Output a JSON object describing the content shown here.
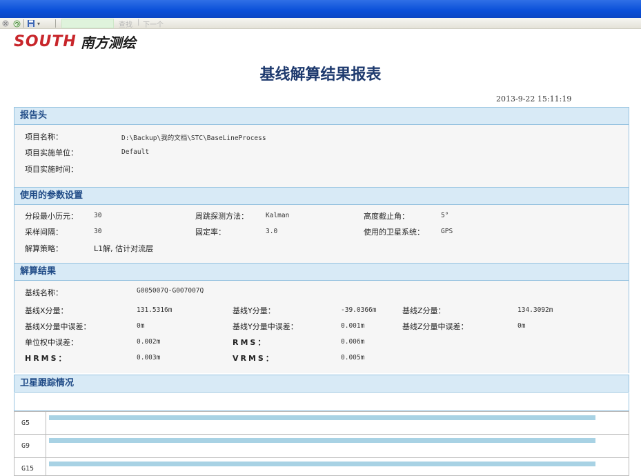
{
  "toolbar": {
    "find_label": "查找",
    "next_label": "下一个",
    "icons": [
      "stop-icon",
      "refresh-icon",
      "save-icon",
      "dropdown-arrow-icon"
    ]
  },
  "logo": {
    "brand": "SOUTH",
    "cn": "南方测绘"
  },
  "report": {
    "title": "基线解算结果报表",
    "timestamp": "2013-9-22 15:11:19"
  },
  "header_section": {
    "title": "报告头",
    "rows": [
      {
        "label": "项目名称：",
        "value": "D:\\Backup\\我的文档\\STC\\BaseLineProcess"
      },
      {
        "label": "项目实施单位：",
        "value": "Default"
      },
      {
        "label": "项目实施时间：",
        "value": ""
      }
    ]
  },
  "params_section": {
    "title": "使用的参数设置",
    "min_epoch_label": "分段最小历元：",
    "min_epoch_value": "30",
    "cycle_slip_label": "周跳探测方法：",
    "cycle_slip_value": "Kalman",
    "cutoff_label": "高度截止角：",
    "cutoff_value": "5°",
    "interval_label": "采样间隔：",
    "interval_value": "30",
    "fixed_label": "固定率：",
    "fixed_value": "3.0",
    "system_label": "使用的卫星系统：",
    "system_value": "GPS",
    "strategy_label": "解算策略：",
    "strategy_value": "L1解, 估计对流层"
  },
  "result_section": {
    "title": "解算结果",
    "baseline_name_label": "基线名称：",
    "baseline_name_value": "G005007Q-G007007Q",
    "dx_label": "基线X分量：",
    "dx_value": "131.5316m",
    "dy_label": "基线Y分量：",
    "dy_value": "-39.0366m",
    "dz_label": "基线Z分量：",
    "dz_value": "134.3092m",
    "dx_err_label": "基线X分量中误差：",
    "dx_err_value": "0m",
    "dy_err_label": "基线Y分量中误差：",
    "dy_err_value": "0.001m",
    "dz_err_label": "基线Z分量中误差：",
    "dz_err_value": "0m",
    "unit_err_label": "单位权中误差：",
    "unit_err_value": "0.002m",
    "rms_label": "RMS：",
    "rms_value": "0.006m",
    "hrms_label": "HRMS：",
    "hrms_value": "0.003m",
    "vrms_label": "VRMS：",
    "vrms_value": "0.005m"
  },
  "satellite_section": {
    "title": "卫星跟踪情况",
    "satellites": [
      "G5",
      "G9",
      "G15"
    ]
  }
}
